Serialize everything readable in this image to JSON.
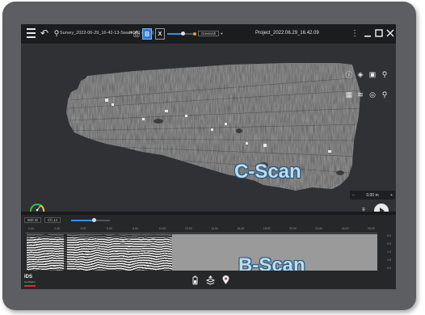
{
  "topbar": {
    "survey_label": "Survey_2022-06-29_16-42-13-Swath001 (GPS)",
    "b_button": "B",
    "x_button": "X",
    "palette_label": "Greenish",
    "project_title": "Project_2022.06.29_16.42.09",
    "slider_value": 0.6
  },
  "cscan": {
    "label": "C-Scan",
    "distance_value": "0.00 m",
    "minus_label": "−",
    "plus_label": "+"
  },
  "bscan": {
    "label": "B-Scan",
    "frequency": "600 W",
    "channel": "Ch.14",
    "slider_value": 0.6,
    "ruler_ticks": [
      "0.00",
      "2.00",
      "4.00",
      "6.00",
      "8.00",
      "10.00",
      "12.00",
      "14.00",
      "16.00",
      "18.00",
      "20.00",
      "22.00",
      "24.00",
      "26.00"
    ],
    "depth_ticks": [
      "0.0",
      "0.5",
      "1.0",
      "1.5",
      "2.0"
    ]
  },
  "brand": {
    "name": "IDS",
    "sub": "GeoRadar"
  },
  "colors": {
    "accent": "#2d7bd6",
    "scan_label": "#bcdcee",
    "brand_red": "#d23030"
  }
}
